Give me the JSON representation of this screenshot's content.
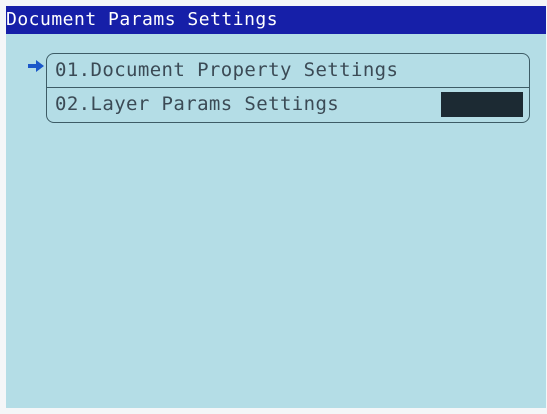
{
  "window": {
    "title": "Document Params Settings"
  },
  "menu": {
    "items": [
      {
        "label": "01.Document Property Settings",
        "selected": true
      },
      {
        "label": "02.Layer Params Settings",
        "selected": false
      }
    ]
  },
  "icons": {
    "pointer": "right-arrow-icon"
  },
  "colors": {
    "title_bar": "#161fa8",
    "screen_bg": "#b4dde6",
    "text": "#3b4a55",
    "pointer": "#1a57c9"
  }
}
